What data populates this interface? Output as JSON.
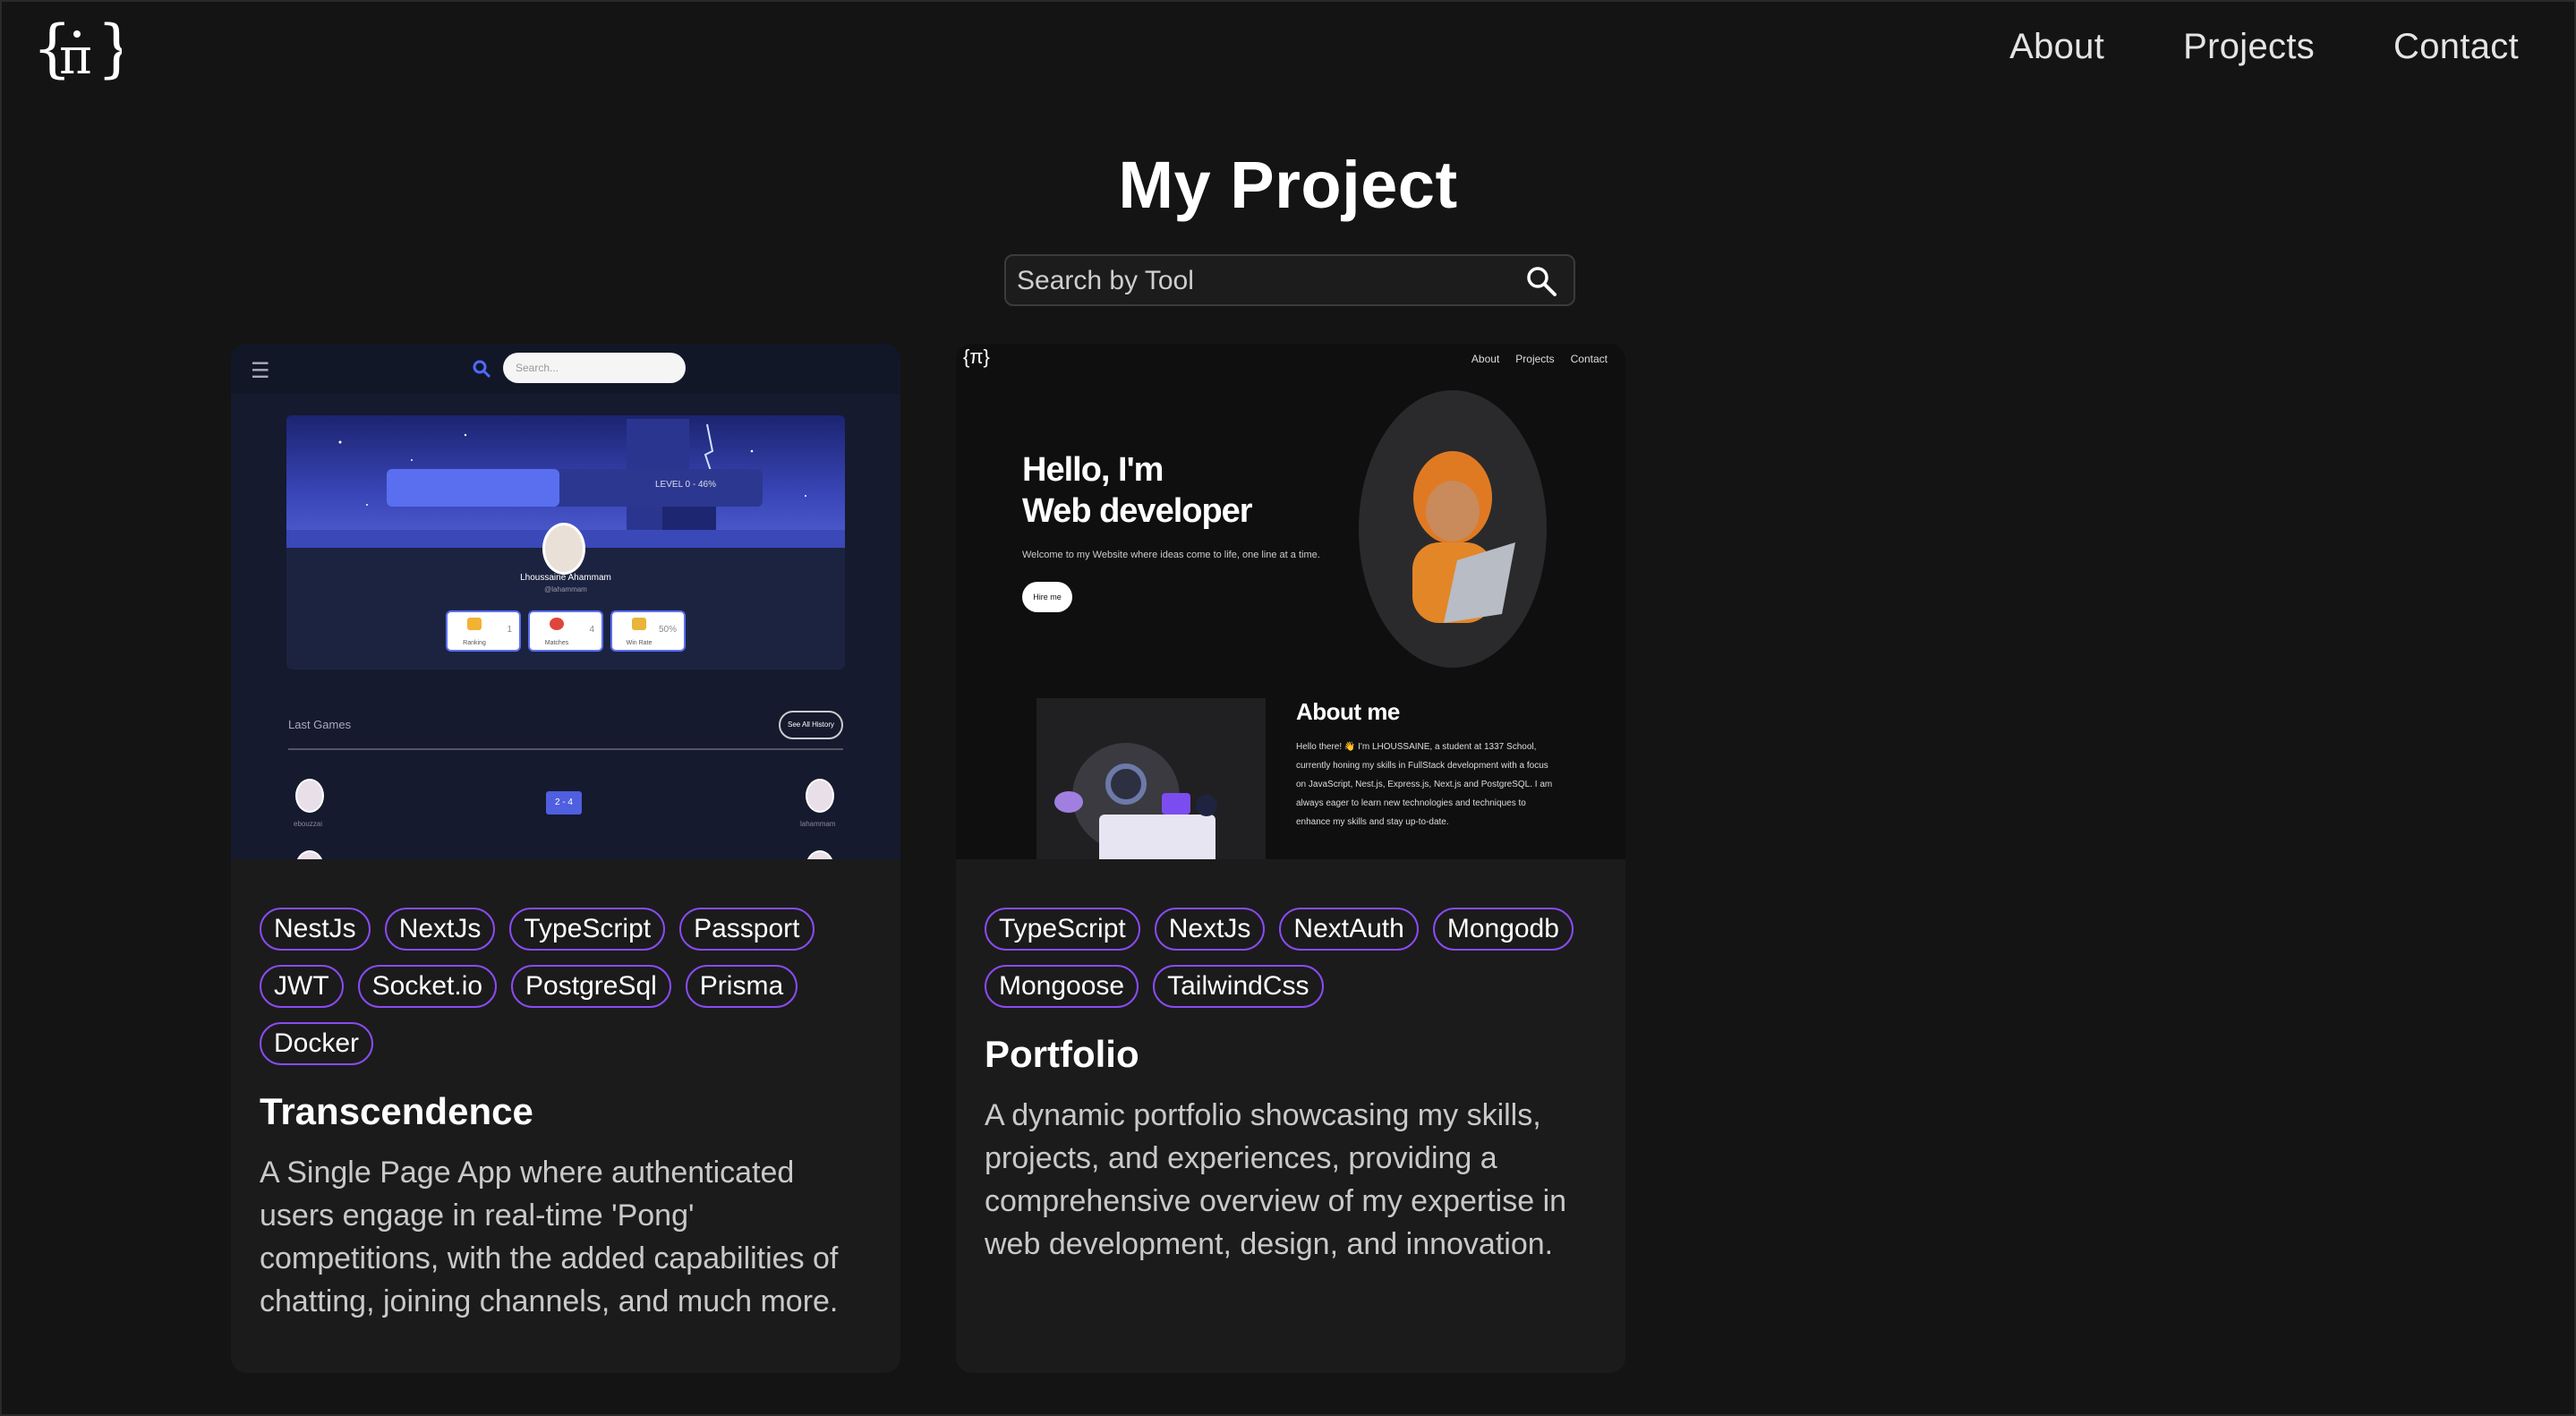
{
  "header": {
    "logo_text": "{π}",
    "nav": [
      {
        "label": "About"
      },
      {
        "label": "Projects"
      },
      {
        "label": "Contact"
      }
    ]
  },
  "main": {
    "title": "My Project",
    "search": {
      "placeholder": "Search by Tool",
      "value": ""
    }
  },
  "projects": [
    {
      "title": "Transcendence",
      "tags": [
        "NestJs",
        "NextJs",
        "TypeScript",
        "Passport",
        "JWT",
        "Socket.io",
        "PostgreSql",
        "Prisma",
        "Docker"
      ],
      "description": "A Single Page App where authenticated users engage in real-time 'Pong' competitions, with the added capabilities of chatting, joining channels, and much more.",
      "preview": {
        "search_placeholder": "Search...",
        "level_text": "LEVEL 0 - 46%",
        "level_progress": 0.46,
        "user_name": "Lhoussaine Ahammam",
        "user_handle": "@lahammam",
        "stats": [
          {
            "label": "Ranking",
            "value": "1"
          },
          {
            "label": "Matches",
            "value": "4"
          },
          {
            "label": "Win Rate",
            "value": "50%"
          }
        ],
        "last_games_label": "Last Games",
        "see_all_label": "See All History",
        "score": "2 - 4",
        "player_left": "ebouzzai",
        "player_right": "lahammam"
      }
    },
    {
      "title": "Portfolio",
      "tags": [
        "TypeScript",
        "NextJs",
        "NextAuth",
        "Mongodb",
        "Mongoose",
        "TailwindCss"
      ],
      "description": "A dynamic portfolio showcasing my skills, projects, and experiences, providing a comprehensive overview of my expertise in web development, design, and innovation.",
      "preview": {
        "logo": "{π}",
        "nav": [
          "About",
          "Projects",
          "Contact"
        ],
        "hello_line1": "Hello, I'm",
        "hello_line2": "Web developer",
        "welcome": "Welcome to my Website where ideas come to life, one line at a time.",
        "hire_label": "Hire me",
        "about_title": "About me",
        "about_text": "Hello there! 👋 I'm LHOUSSAINE, a student at 1337 School, currently honing my skills in FullStack development with a focus on JavaScript, Nest.js, Express.js, Next.js and PostgreSQL. I am always eager to learn new technologies and techniques to enhance my skills and stay up-to-date."
      }
    }
  ],
  "colors": {
    "background": "#141414",
    "card": "#1b1b1c",
    "tag_border": "#8a4bf0",
    "text_muted": "#c9c9c9"
  },
  "icons": [
    "pi-logo-icon",
    "search-icon"
  ]
}
